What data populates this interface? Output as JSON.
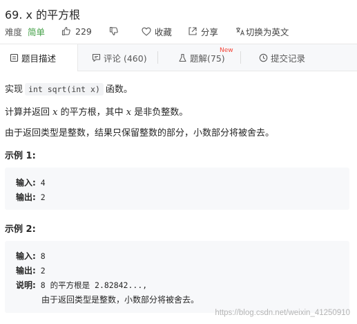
{
  "problem": {
    "title_prefix": "69.",
    "title_var": "x",
    "title_suffix": "的平方根",
    "difficulty_label": "难度",
    "difficulty": "简单",
    "likes": "229",
    "favorite_label": "收藏",
    "share_label": "分享",
    "switch_lang_label": "切换为英文"
  },
  "tabs": [
    {
      "label": "题目描述",
      "icon": "document-icon"
    },
    {
      "label": "评论 (460)",
      "icon": "comment-icon"
    },
    {
      "label": "题解(75)",
      "icon": "flask-icon",
      "badge": "New"
    },
    {
      "label": "提交记录",
      "icon": "clock-icon"
    }
  ],
  "description": {
    "p1_prefix": "实现",
    "p1_code": "int sqrt(int x)",
    "p1_suffix": "函数。",
    "p2_a": "计算并返回",
    "p2_var1": "x",
    "p2_b": "的平方根，其中",
    "p2_var2": "x",
    "p2_c": "是非负整数。",
    "p3": "由于返回类型是整数，结果只保留整数的部分，小数部分将被舍去。"
  },
  "examples": [
    {
      "heading": "示例 1:",
      "input_label": "输入:",
      "input": "4",
      "output_label": "输出:",
      "output": "2"
    },
    {
      "heading": "示例 2:",
      "input_label": "输入:",
      "input": "8",
      "output_label": "输出:",
      "output": "2",
      "explain_label": "说明:",
      "explain_1": "8 的平方根是 2.82842...,",
      "explain_2": "由于返回类型是整数，小数部分将被舍去。"
    }
  ],
  "watermark": "https://blog.csdn.net/weixin_41250910",
  "colors": {
    "easy_green": "#43a047",
    "new_badge_red": "#f44336",
    "tab_bar_bg": "#f7f8fa",
    "code_block_bg": "#f7f8fa"
  }
}
